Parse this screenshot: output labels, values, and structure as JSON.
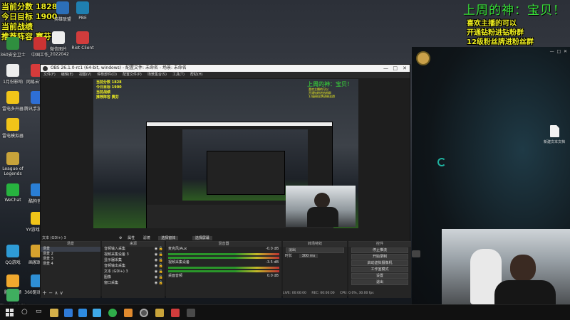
{
  "overlay": {
    "score_line1": "当前分数 1828",
    "score_line2": "今日目标 1900",
    "score_line3": "当前战绩",
    "score_line4": "推荐阵容 赛芬",
    "top_right_title": "上周的神：宝贝！",
    "top_right_line1": "喜欢主播的可以",
    "top_right_line2": "开通钻粉进钻粉群",
    "top_right_line3": "12级粉丝牌进粉丝群"
  },
  "desktop_icons": [
    {
      "label": "360安全卫士",
      "color": "#2f8f3f"
    },
    {
      "label": "中国工作",
      "color": "#cc3333"
    },
    {
      "label": "微信图片_2022042",
      "color": "#eeeeee"
    },
    {
      "label": "Riot Client",
      "color": "#d13c3c"
    },
    {
      "label": "PBE",
      "color": "#1f7fb0"
    },
    {
      "label": "1月份影响",
      "color": "#eeeeee"
    },
    {
      "label": "网易云音乐",
      "color": "#d63b3b"
    },
    {
      "label": "雷电多开器",
      "color": "#f0c419"
    },
    {
      "label": "腾讯手游助手",
      "color": "#2e6fd6"
    },
    {
      "label": "雷电模拟器",
      "color": "#f0c419"
    },
    {
      "label": "League of Legends",
      "color": "#c8a33a"
    },
    {
      "label": "WeChat",
      "color": "#27b33f"
    },
    {
      "label": "酷狗音乐",
      "color": "#2a7fd6"
    },
    {
      "label": "YY游戏大厅",
      "color": "#f0c419"
    },
    {
      "label": "QQ游戏",
      "color": "#2e9bd6"
    },
    {
      "label": "画家助手",
      "color": "#d6a22e"
    },
    {
      "label": "英雄联盟",
      "color": "#2c6fb8"
    },
    {
      "label": "腾讯视频",
      "color": "#f0a82e"
    },
    {
      "label": "360驱动大师",
      "color": "#2e8fd6"
    },
    {
      "label": "腾讯儿童翻牌",
      "color": "#3fae5f"
    },
    {
      "label": "新建文本文档",
      "color": "#eeeeee"
    }
  ],
  "obs": {
    "title": "OBS 26.1.0-rc1 (64-bit, windows) - 配置文件: 未命名 - 场景: 未命名",
    "menu": [
      "文件(F)",
      "编辑(E)",
      "视图(V)",
      "停靠部件(D)",
      "配置文件(P)",
      "场景集合(S)",
      "工具(T)",
      "帮助(H)"
    ],
    "status_text": "文本 (GDI+) 3",
    "buttons": {
      "properties": "属性",
      "filters": "滤镜",
      "select_window": "选择窗体",
      "select_screen": "选择屏幕"
    },
    "docks": {
      "scenes_title": "场景",
      "sources_title": "来源",
      "mixer_title": "混音器",
      "transitions_title": "转场特效",
      "controls_title": "控件"
    },
    "scenes": [
      "场景",
      "场景 2",
      "场景 3",
      "场景 4"
    ],
    "sources": [
      "音频输入采集",
      "视频采集设备 3",
      "显示器采集",
      "音频输出采集",
      "文本 (GDI+) 3",
      "图像",
      "窗口采集"
    ],
    "mixer": {
      "ch1_name": "麦克风/Aux",
      "ch1_db": "-0.0 dB",
      "ch2_name": "视频采集设备",
      "ch2_db": "-3.5 dB",
      "ch3_name": "桌面音频",
      "ch3_db": "0.0 dB"
    },
    "transitions": {
      "type": "淡出",
      "duration_label": "时长",
      "duration_value": "300 ms"
    },
    "controls": [
      "停止推流",
      "开始录制",
      "启动虚拟摄像机",
      "工作室模式",
      "设置",
      "退出"
    ],
    "statusbar": {
      "live": "LIVE: 00:00:00",
      "rec": "REC: 00:00:00",
      "cpu": "CPU: 0.0%, 30.00 fps"
    }
  },
  "right_window": {
    "doc_label": "新建文本文档"
  },
  "colors": {
    "overlay_yellow": "#f0f020",
    "overlay_green": "#39e639",
    "obs_bg": "#1e1e1e",
    "taskbar": "#111111"
  }
}
